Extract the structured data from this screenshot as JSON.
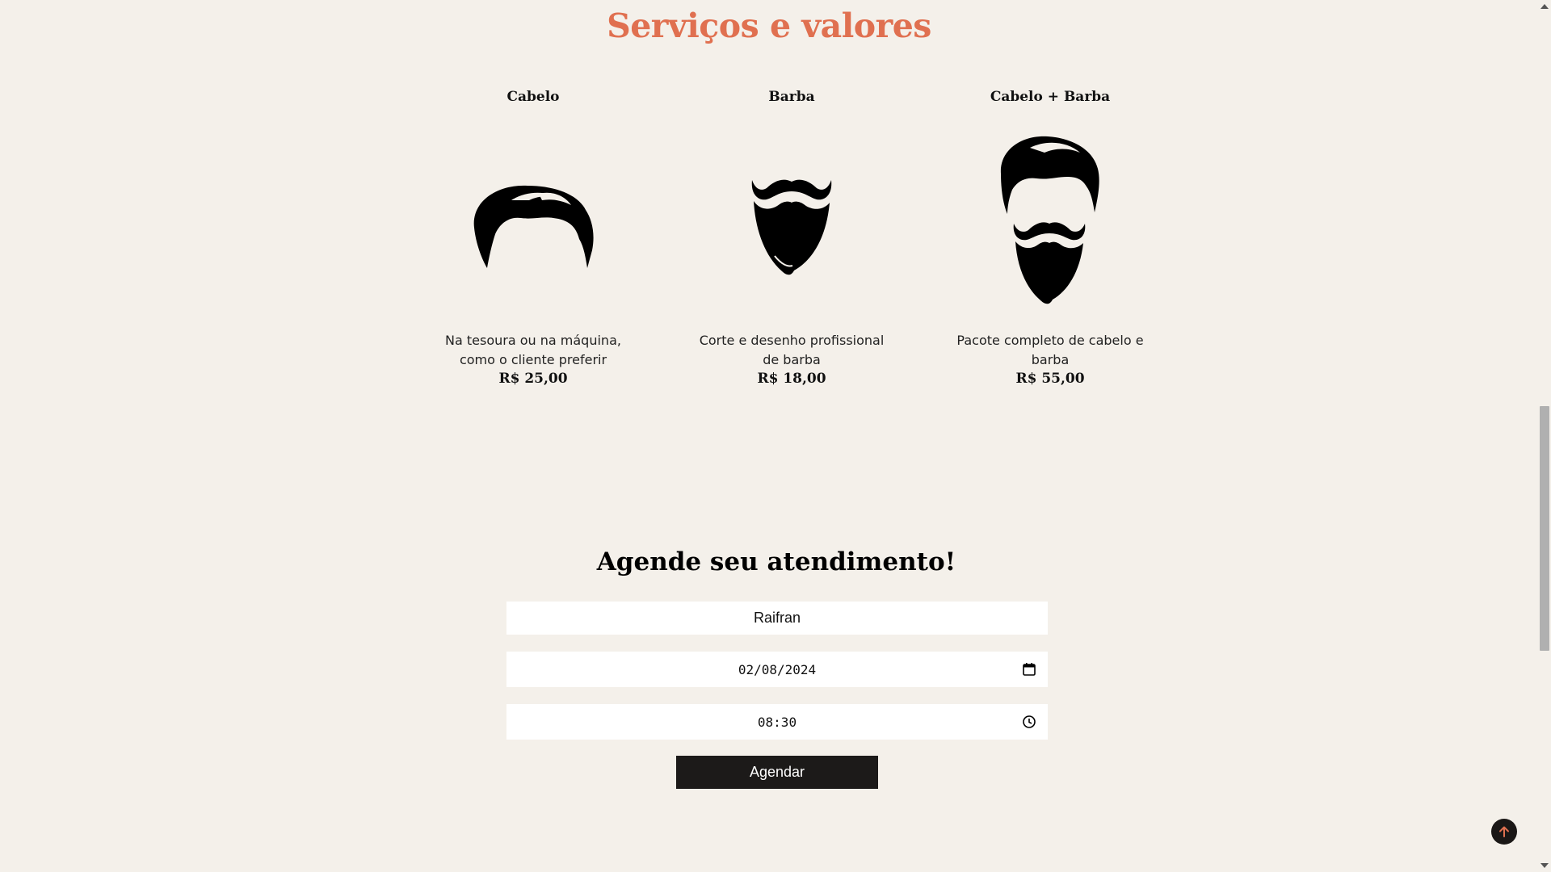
{
  "services_section": {
    "title": "Serviços e valores",
    "items": [
      {
        "name": "Cabelo",
        "icon": "hair-icon",
        "description": "Na tesoura ou na máquina, como o cliente preferir",
        "price": "R$ 25,00"
      },
      {
        "name": "Barba",
        "icon": "beard-icon",
        "description": "Corte e desenho profissional de barba",
        "price": "R$ 18,00"
      },
      {
        "name": "Cabelo + Barba",
        "icon": "hair-and-beard-icon",
        "description": "Pacote completo de cabelo e barba",
        "price": "R$ 55,00"
      }
    ]
  },
  "booking": {
    "title": "Agende seu atendimento!",
    "name_value": "Raifran",
    "date_value": "02/08/2024",
    "time_value": "08:30",
    "submit_label": "Agendar"
  },
  "colors": {
    "background": "#f4f0ea",
    "accent": "#e07050",
    "button": "#1c1a19"
  }
}
